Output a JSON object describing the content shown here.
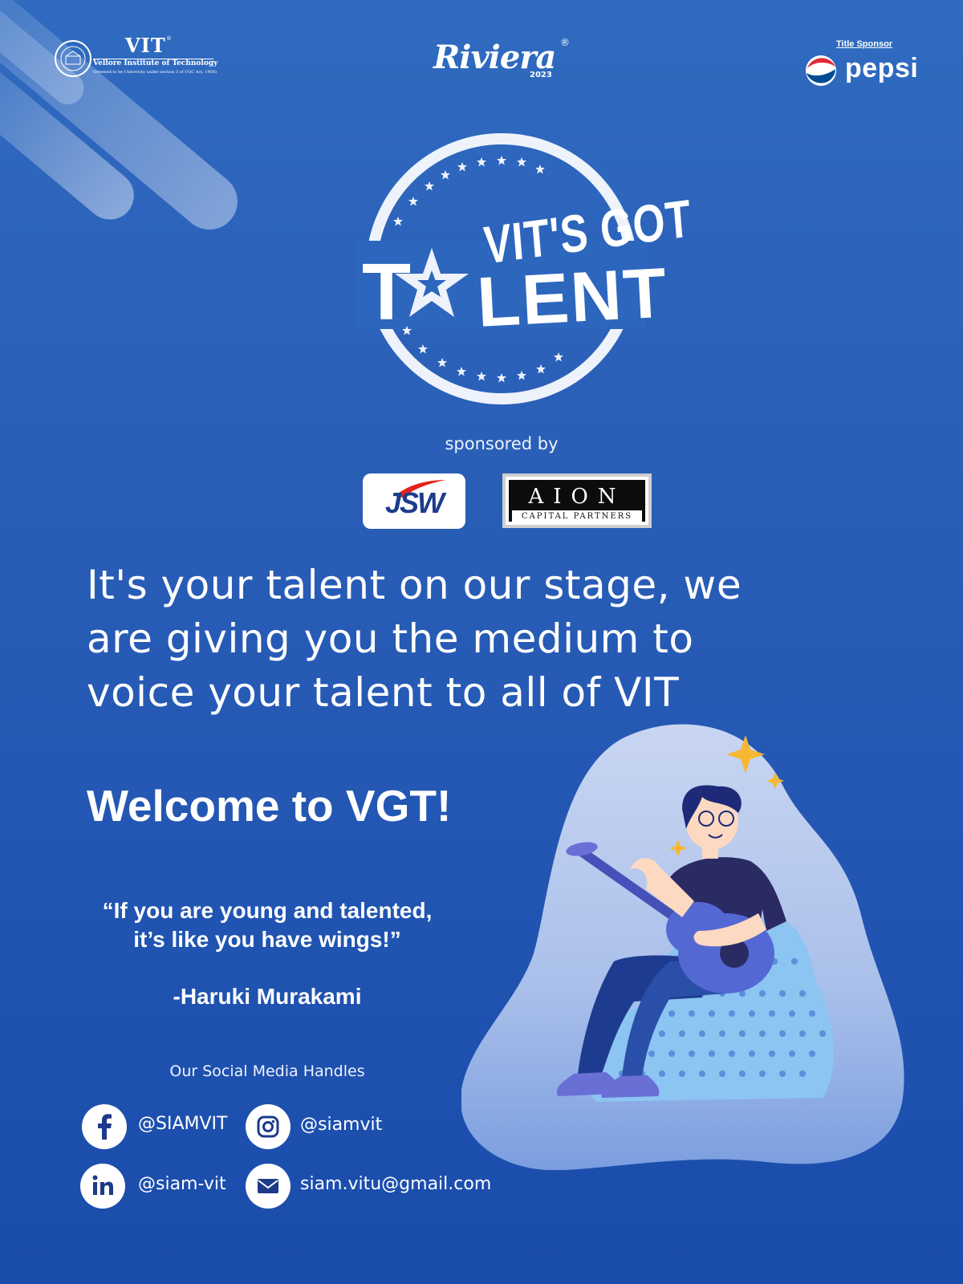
{
  "header": {
    "vit": {
      "name": "VIT",
      "full_name": "Vellore Institute of Technology",
      "subtitle": "(Deemed to be University under section 3 of UGC Act, 1956)",
      "registered": "®"
    },
    "riviera": {
      "name": "Riviera",
      "year": "2023",
      "registered": "®"
    },
    "pepsi": {
      "label": "Title Sponsor",
      "name": "pepsi"
    }
  },
  "emblem": {
    "line1": "VIT'S GOT",
    "line2_start": "T",
    "line2_end": "LENT"
  },
  "sponsors": {
    "heading": "sponsored by",
    "jsw": "JSW",
    "aion": "AION",
    "aion_sub": "CAPITAL PARTNERS"
  },
  "tagline": "It's your talent on our stage, we are giving you the medium to voice your talent to all of VIT",
  "welcome": "Welcome to VGT!",
  "quote": {
    "text": "“If you are young and talented, it’s like you have wings!”",
    "author": "-Haruki Murakami"
  },
  "social": {
    "heading": "Our Social Media Handles",
    "facebook": "@SIAMVIT",
    "instagram": "@siamvit",
    "linkedin": "@siam-vit",
    "email": "siam.vitu@gmail.com"
  },
  "colors": {
    "background_top": "#2f6bc0",
    "background_bottom": "#1a4cab",
    "blob": "#b8c8ec",
    "star_accent": "#f7b733",
    "guitar": "#5468d4",
    "beanbag": "#8cc4f2"
  }
}
